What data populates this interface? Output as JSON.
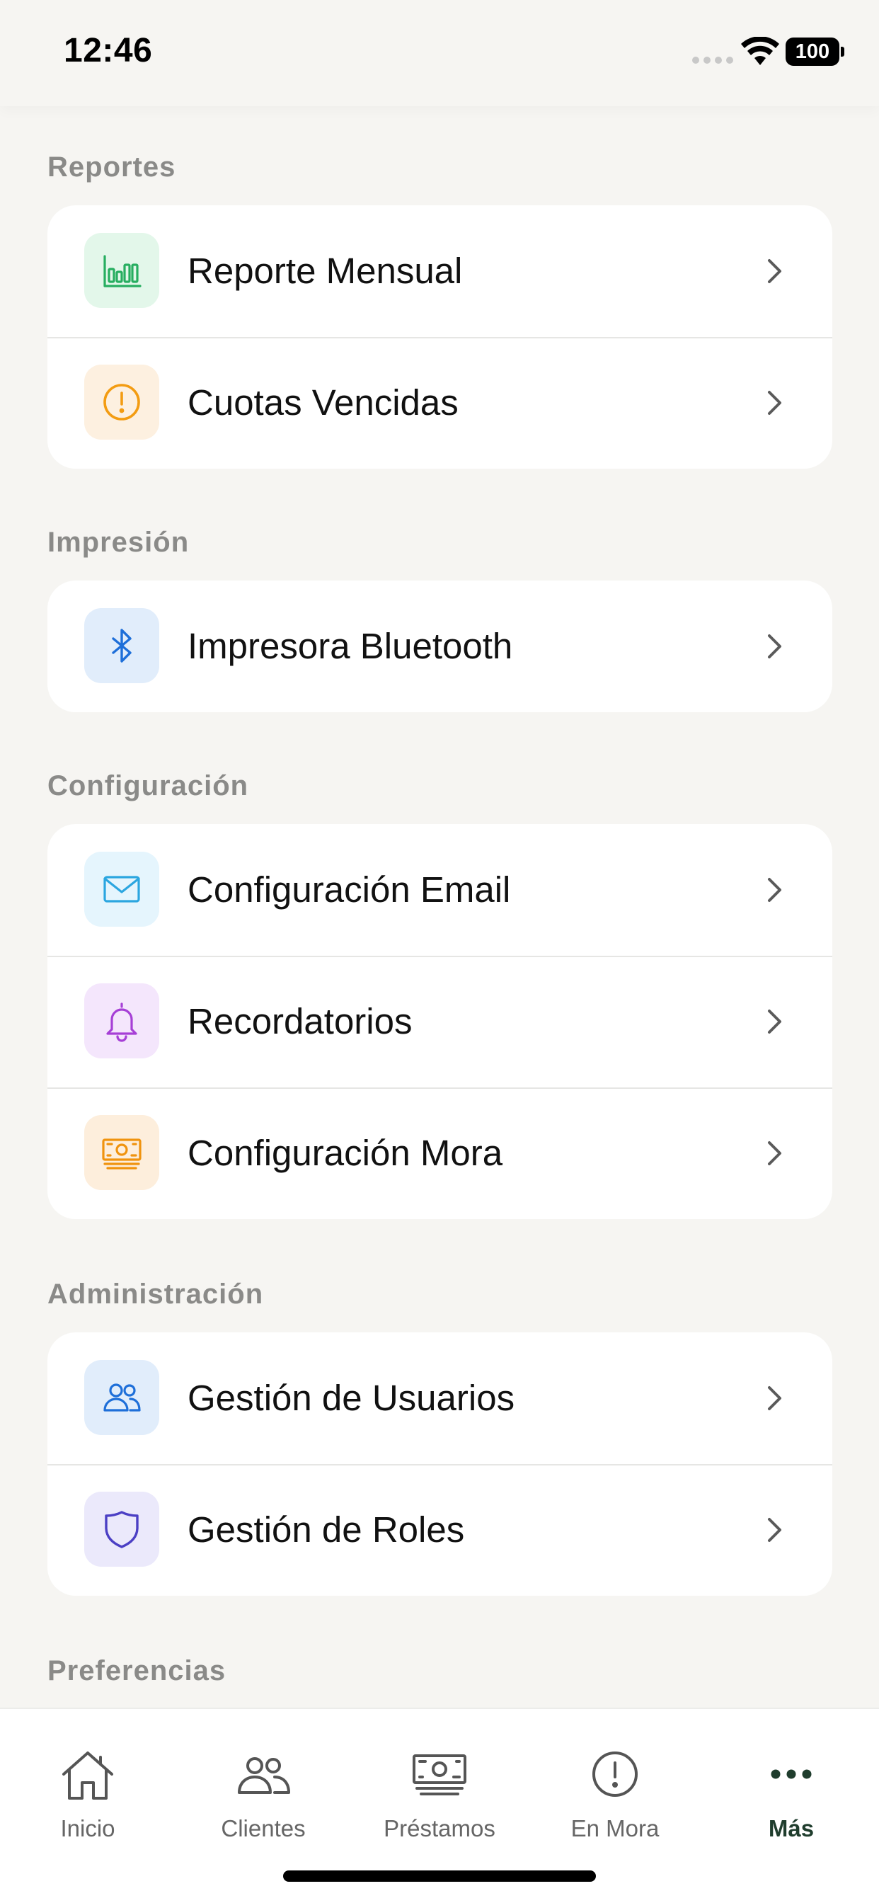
{
  "status_bar": {
    "time": "12:46",
    "battery": "100"
  },
  "sections": {
    "reportes": {
      "title": "Reportes",
      "items": [
        {
          "label": "Reporte Mensual",
          "icon": "bar-chart-icon",
          "color": "#27ae60",
          "bg": "#e3f7ea"
        },
        {
          "label": "Cuotas Vencidas",
          "icon": "alert-circle-icon",
          "color": "#f39c12",
          "bg": "#fdf0e0"
        }
      ]
    },
    "impresion": {
      "title": "Impresión",
      "items": [
        {
          "label": "Impresora Bluetooth",
          "icon": "bluetooth-icon",
          "color": "#1e6fd9",
          "bg": "#e1edfb"
        }
      ]
    },
    "configuracion": {
      "title": "Configuración",
      "items": [
        {
          "label": "Configuración Email",
          "icon": "mail-icon",
          "color": "#2ba6e0",
          "bg": "#e5f5fd"
        },
        {
          "label": "Recordatorios",
          "icon": "bell-icon",
          "color": "#a63fd6",
          "bg": "#f4e6fc"
        },
        {
          "label": "Configuración Mora",
          "icon": "cash-icon",
          "color": "#f0930e",
          "bg": "#fdeedc"
        }
      ]
    },
    "administracion": {
      "title": "Administración",
      "items": [
        {
          "label": "Gestión de Usuarios",
          "icon": "users-icon",
          "color": "#1e6fd9",
          "bg": "#e1edfb"
        },
        {
          "label": "Gestión de Roles",
          "icon": "shield-icon",
          "color": "#4b3fc4",
          "bg": "#ebe9fb"
        }
      ]
    },
    "preferencias": {
      "title": "Preferencias"
    }
  },
  "tab_bar": {
    "tabs": [
      {
        "label": "Inicio",
        "icon": "home-icon"
      },
      {
        "label": "Clientes",
        "icon": "users-icon"
      },
      {
        "label": "Préstamos",
        "icon": "cash-icon"
      },
      {
        "label": "En Mora",
        "icon": "alert-circle-icon"
      },
      {
        "label": "Más",
        "icon": "more-icon",
        "active": true
      }
    ],
    "active_color": "#1f3d2d",
    "inactive_color": "#666666"
  }
}
